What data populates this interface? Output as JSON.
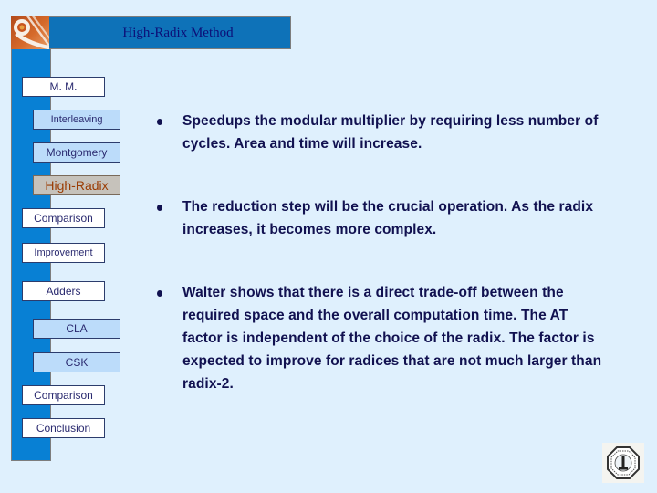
{
  "header": {
    "title": "High-Radix Method",
    "logo_icon": "university-logo-icon"
  },
  "sidebar": {
    "items": [
      {
        "label": "M. M.",
        "level": "main",
        "active": false
      },
      {
        "label": "Interleaving",
        "level": "sub",
        "active": false
      },
      {
        "label": "Montgomery",
        "level": "sub",
        "active": false
      },
      {
        "label": "High-Radix",
        "level": "sub",
        "active": true
      },
      {
        "label": "Comparison",
        "level": "main",
        "active": false
      },
      {
        "label": "Improvement",
        "level": "main",
        "active": false
      },
      {
        "label": "Adders",
        "level": "main",
        "active": false
      },
      {
        "label": "CLA",
        "level": "sub",
        "active": false
      },
      {
        "label": "CSK",
        "level": "sub",
        "active": false
      },
      {
        "label": "Comparison",
        "level": "main",
        "active": false
      },
      {
        "label": "Conclusion",
        "level": "main",
        "active": false
      }
    ]
  },
  "content": {
    "bullets": [
      "Speedups the modular multiplier by requiring less number of cycles. Area and time will increase.",
      "The reduction step will be the crucial operation. As the radix increases, it becomes more complex.",
      "Walter shows that there is a direct trade-off between the required space and the overall computation time. The AT factor is independent of the choice of the radix. The factor is expected to improve for radices that are not much larger than radix-2."
    ]
  },
  "footer": {
    "seal_icon": "university-seal-icon"
  },
  "colors": {
    "background": "#dff0fd",
    "header_bar": "#0e72b8",
    "title_text": "#0c0f78",
    "active_nav_text": "#9a3c04",
    "body_text": "#111150"
  }
}
